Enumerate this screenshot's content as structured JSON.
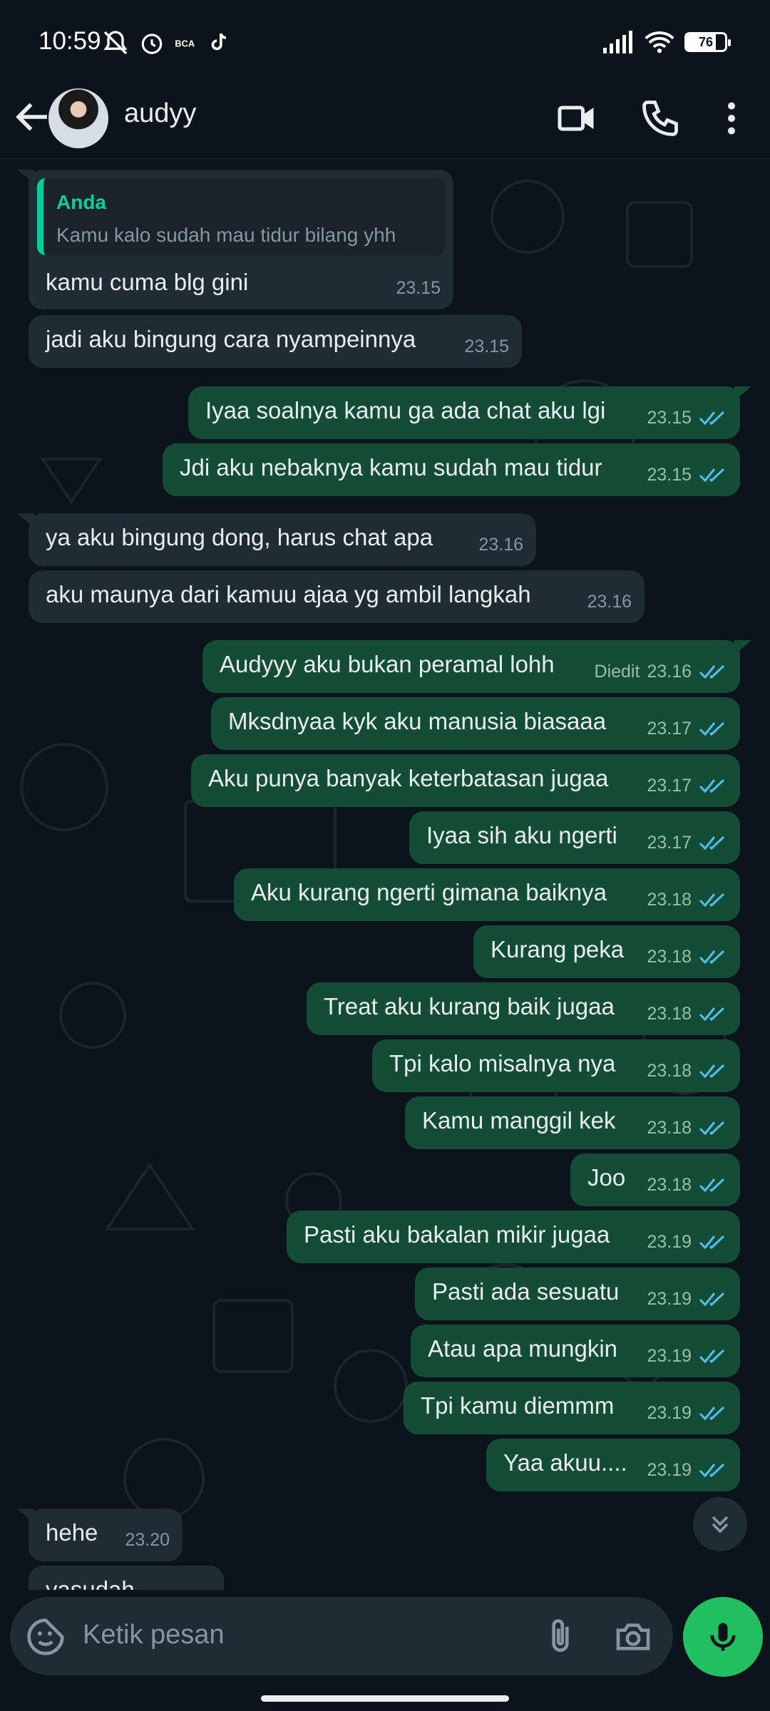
{
  "status_bar": {
    "time": "10:59",
    "battery": "76"
  },
  "header": {
    "contact_name": "audyy"
  },
  "quoted_message": {
    "author": "Anda",
    "text": "Kamu kalo sudah mau tidur bilang yhh"
  },
  "messages": [
    {
      "dir": "in",
      "text": "kamu cuma blg gini",
      "time": "23.15"
    },
    {
      "dir": "in",
      "text": "jadi aku bingung cara nyampeinnya",
      "time": "23.15"
    },
    {
      "dir": "out",
      "text": "Iyaa soalnya kamu ga ada chat aku lgi",
      "time": "23.15"
    },
    {
      "dir": "out",
      "text": "Jdi aku nebaknya kamu sudah mau tidur",
      "time": "23.15"
    },
    {
      "dir": "in",
      "text": "ya aku bingung dong, harus chat apa",
      "time": "23.16"
    },
    {
      "dir": "in",
      "text": "aku maunya dari kamuu ajaa yg ambil langkah",
      "time": "23.16"
    },
    {
      "dir": "out",
      "text": "Audyyy aku bukan peramal lohh",
      "time": "23.16",
      "edited": "Diedit"
    },
    {
      "dir": "out",
      "text": "Mksdnyaa kyk aku manusia biasaaa",
      "time": "23.17"
    },
    {
      "dir": "out",
      "text": "Aku punya banyak keterbatasan jugaa",
      "time": "23.17"
    },
    {
      "dir": "out",
      "text": "Iyaa sih aku ngerti",
      "time": "23.17"
    },
    {
      "dir": "out",
      "text": "Aku kurang ngerti gimana baiknya",
      "time": "23.18"
    },
    {
      "dir": "out",
      "text": "Kurang peka",
      "time": "23.18"
    },
    {
      "dir": "out",
      "text": "Treat aku kurang baik jugaa",
      "time": "23.18"
    },
    {
      "dir": "out",
      "text": "Tpi kalo misalnya nya",
      "time": "23.18"
    },
    {
      "dir": "out",
      "text": "Kamu manggil kek",
      "time": "23.18"
    },
    {
      "dir": "out",
      "text": "Joo",
      "time": "23.18"
    },
    {
      "dir": "out",
      "text": "Pasti aku bakalan mikir jugaa",
      "time": "23.19"
    },
    {
      "dir": "out",
      "text": "Pasti ada sesuatu",
      "time": "23.19"
    },
    {
      "dir": "out",
      "text": "Atau apa mungkin",
      "time": "23.19"
    },
    {
      "dir": "out",
      "text": "Tpi kamu diemmm",
      "time": "23.19"
    },
    {
      "dir": "out",
      "text": "Yaa akuu....",
      "time": "23.19"
    },
    {
      "dir": "in",
      "text": "hehe",
      "time": "23.20"
    },
    {
      "dir": "in",
      "text": "yasudah",
      "time": ""
    }
  ],
  "composer": {
    "placeholder": "Ketik pesan"
  },
  "colors": {
    "accent": "#21c063",
    "outgoing": "#144d37",
    "incoming": "#202c33",
    "read_tick": "#53bdeb"
  }
}
